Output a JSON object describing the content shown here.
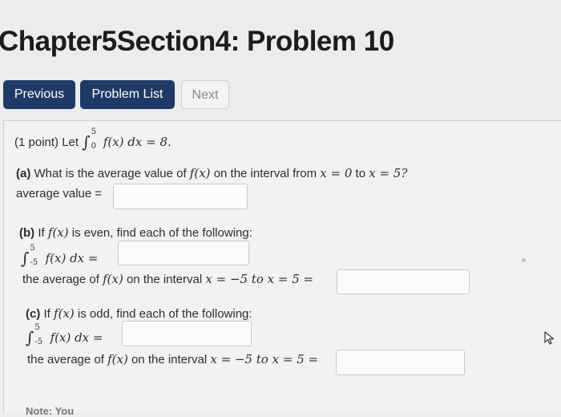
{
  "page": {
    "title": "Chapter5Section4: Problem 10"
  },
  "nav": {
    "previous": "Previous",
    "problem_list": "Problem List",
    "next": "Next"
  },
  "problem": {
    "intro_prefix": "(1 point) Let",
    "intro_expr": "f(x) dx = 8.",
    "intro_upper": "5",
    "intro_lower": "0",
    "part_a": {
      "tag": "(a)",
      "question_pre": "What is the average value of",
      "question_fx": "f(x)",
      "question_mid": "on the interval from",
      "question_x0": "x = 0",
      "question_to": "to",
      "question_x5": "x = 5?",
      "answer_label": "average value =",
      "answer_value": ""
    },
    "part_b": {
      "tag": "(b)",
      "question_pre": "If",
      "question_fx": "f(x)",
      "question_post": "is even, find each of the following:",
      "integral_upper": "5",
      "integral_lower": "-5",
      "integral_expr": "f(x) dx =",
      "integral_value": "",
      "avg_pre": "the average of",
      "avg_fx": "f(x)",
      "avg_mid": "on the interval",
      "avg_range": "x = −5 to x = 5 =",
      "avg_value": ""
    },
    "part_c": {
      "tag": "(c)",
      "question_pre": "If",
      "question_fx": "f(x)",
      "question_post": "is odd, find each of the following:",
      "integral_upper": "5",
      "integral_lower": "-5",
      "integral_expr": "f(x) dx =",
      "integral_value": "",
      "avg_pre": "the average of",
      "avg_fx": "f(x)",
      "avg_mid": "on the interval",
      "avg_range": "x = −5 to x = 5 =",
      "avg_value": ""
    },
    "note_partial": "Note: You"
  },
  "icons": {
    "cursor": "mouse-cursor-icon"
  }
}
